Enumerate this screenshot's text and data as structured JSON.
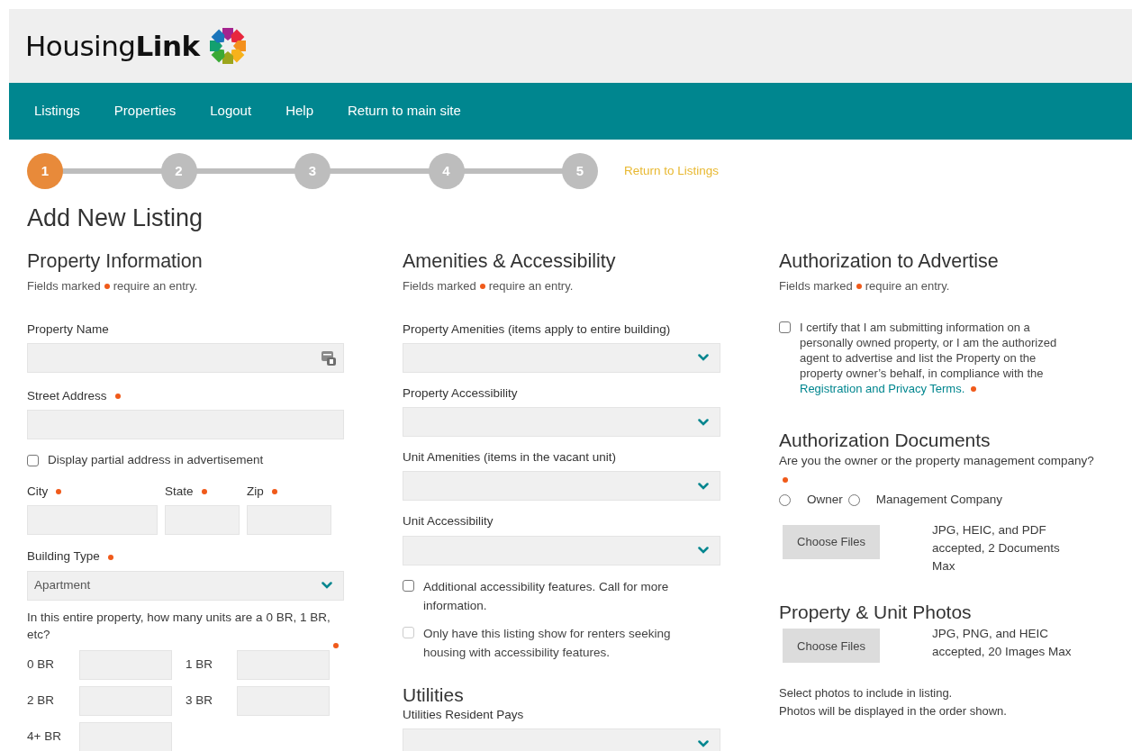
{
  "header": {
    "logo": "Housing**Link**"
  },
  "nav": {
    "items": [
      {
        "label": "Listings"
      },
      {
        "label": "Properties"
      },
      {
        "label": "Logout"
      },
      {
        "label": "Help"
      },
      {
        "label": "Return to main site"
      }
    ]
  },
  "steps": {
    "items": [
      {
        "label": "1",
        "selected": true
      },
      {
        "label": "2",
        "selected": false
      },
      {
        "label": "3",
        "selected": false
      },
      {
        "label": "4",
        "selected": false
      },
      {
        "label": "5",
        "selected": false
      }
    ],
    "return_link": "Return to Listings"
  },
  "page_title": "Add New Listing",
  "columns": [
    {
      "blocks": [
        {
          "kind": "heading",
          "text": "Property Information"
        },
        {
          "kind": "hint",
          "before": "Fields marked",
          "after": "require an entry."
        },
        {
          "kind": "text",
          "label": "Property Name",
          "required": false,
          "card_icon": true
        },
        {
          "kind": "text",
          "label": "Street Address",
          "required": true,
          "card_icon": false
        },
        {
          "kind": "checkbox",
          "label": "Display partial address in advertisement",
          "checked": false,
          "disabled": false
        },
        {
          "kind": "row",
          "fields": [
            {
              "label": "City",
              "required": true
            },
            {
              "label": "State",
              "required": true
            },
            {
              "label": "Zip",
              "required": true
            }
          ]
        },
        {
          "kind": "select",
          "label": "Building Type",
          "required": true,
          "value": "Apartment"
        },
        {
          "kind": "question",
          "text": "In this entire property, how many units are a 0 BR, 1 BR, etc?",
          "required": true
        },
        {
          "kind": "grid",
          "fields": [
            {
              "label": "0 BR"
            },
            {
              "label": "1 BR"
            },
            {
              "label": "2 BR"
            },
            {
              "label": "3 BR"
            },
            {
              "label": "4+ BR"
            }
          ]
        }
      ]
    },
    {
      "blocks": [
        {
          "kind": "heading",
          "text": "Amenities & Accessibility"
        },
        {
          "kind": "hint",
          "before": "Fields marked",
          "after": "require an entry."
        },
        {
          "kind": "select",
          "label": "Property Amenities (items apply to entire building)",
          "required": false
        },
        {
          "kind": "select",
          "label": "Property Accessibility",
          "required": false
        },
        {
          "kind": "select",
          "label": "Unit Amenities (items in the vacant unit)",
          "required": false
        },
        {
          "kind": "select",
          "label": "Unit Accessibility",
          "required": false
        },
        {
          "kind": "checkbox",
          "label": "Additional accessibility features. Call for more information.",
          "checked": false,
          "disabled": false
        },
        {
          "kind": "checkbox",
          "label": "Only have this listing show for renters seeking housing with accessibility features.",
          "checked": false,
          "disabled": true
        },
        {
          "kind": "subheading",
          "text": "Utilities"
        },
        {
          "kind": "select",
          "label": "Utilities Resident Pays",
          "required": false
        }
      ]
    },
    {
      "blocks": [
        {
          "kind": "heading",
          "text": "Authorization to Advertise"
        },
        {
          "kind": "hint",
          "before": "Fields marked",
          "after": "require an entry."
        },
        {
          "kind": "certify",
          "text": "I certify that I am submitting information on a personally owned property, or I am the authorized agent to advertise and list the Property on the property owner’s behalf, in compliance with the",
          "link": "Registration and Privacy Terms.",
          "checked": false,
          "required": true
        },
        {
          "kind": "subheading",
          "text": "Authorization Documents"
        },
        {
          "kind": "question",
          "text": "Are you the owner or the property management company?",
          "required": true
        },
        {
          "kind": "radios",
          "options": [
            {
              "label": "Owner",
              "selected": false
            },
            {
              "label": "Management Company",
              "selected": false
            }
          ]
        },
        {
          "kind": "file",
          "button": "Choose Files",
          "note": "JPG, HEIC, and PDF accepted, 2 Documents Max"
        },
        {
          "kind": "subheading",
          "text": "Property & Unit Photos"
        },
        {
          "kind": "file",
          "button": "Choose Files",
          "note": "JPG, PNG, and HEIC accepted, 20 Images Max"
        },
        {
          "kind": "notes",
          "lines": [
            "Select photos to include in listing.",
            "Photos will be displayed in the order shown."
          ]
        }
      ]
    }
  ]
}
